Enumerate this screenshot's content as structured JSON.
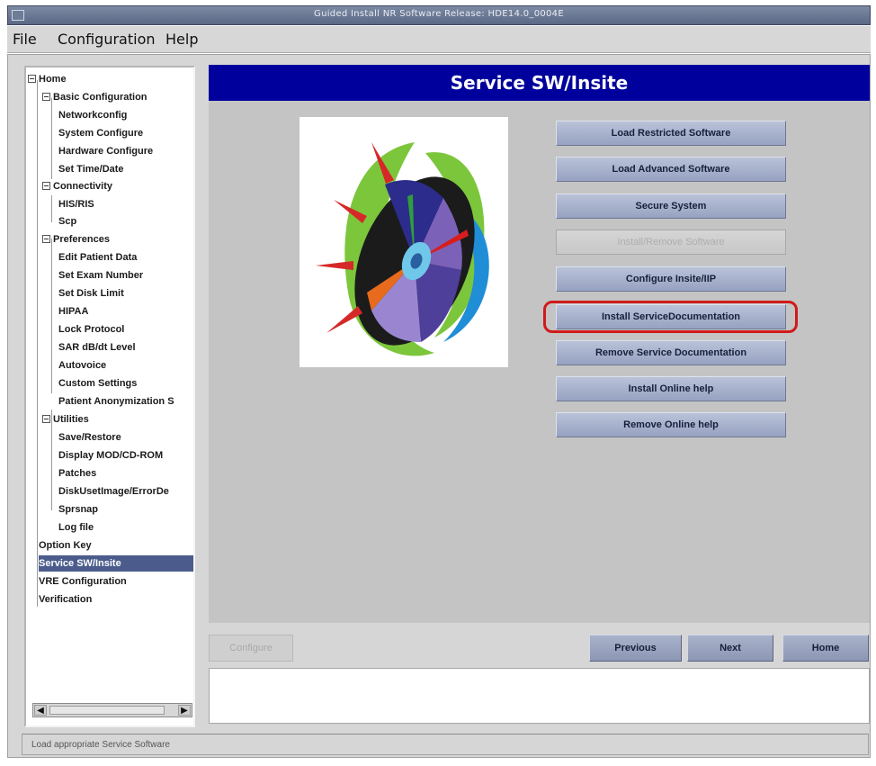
{
  "window": {
    "title": "Guided Install  NR Software Release: HDE14.0_0004E"
  },
  "menu": {
    "items": [
      "File",
      "Configuration",
      "Help"
    ]
  },
  "tree": {
    "root": "Home",
    "groups": [
      {
        "label": "Basic Configuration",
        "children": [
          "Networkconfig",
          "System Configure",
          "Hardware Configure",
          "Set Time/Date"
        ]
      },
      {
        "label": "Connectivity",
        "children": [
          "HIS/RIS",
          "Scp"
        ]
      },
      {
        "label": "Preferences",
        "children": [
          "Edit Patient Data",
          "Set Exam Number",
          "Set Disk Limit",
          "HIPAA",
          "Lock Protocol",
          "SAR dB/dt Level",
          "Autovoice",
          "Custom Settings",
          "Patient Anonymization S"
        ]
      },
      {
        "label": "Utilities",
        "children": [
          "Save/Restore",
          "Display MOD/CD-ROM",
          "Patches",
          "DiskUsetImage/ErrorDe",
          "Sprsnap",
          "Log file"
        ]
      }
    ],
    "top_level": [
      "Option Key",
      "Service SW/Insite",
      "VRE Configuration",
      "Verification"
    ],
    "selected": "Service SW/Insite"
  },
  "scrollbar": {
    "left_arrow": "◀",
    "right_arrow": "▶"
  },
  "header": {
    "title": "Service SW/Insite"
  },
  "image": {
    "icon": "cd-disc-icon"
  },
  "actions": [
    {
      "label": "Load Restricted Software",
      "enabled": true
    },
    {
      "label": "Load Advanced Software",
      "enabled": true
    },
    {
      "label": "Secure System",
      "enabled": true
    },
    {
      "label": "Install/Remove Software",
      "enabled": false
    },
    {
      "label": "Configure Insite/IIP",
      "enabled": true
    },
    {
      "label": "Install ServiceDocumentation",
      "enabled": true,
      "highlighted": true
    },
    {
      "label": "Remove Service Documentation",
      "enabled": true
    },
    {
      "label": "Install Online help",
      "enabled": true
    },
    {
      "label": "Remove Online help",
      "enabled": true
    }
  ],
  "nav": {
    "configure": "Configure",
    "previous": "Previous",
    "next": "Next",
    "home": "Home"
  },
  "status": {
    "text": "Load appropriate Service Software"
  },
  "colors": {
    "header": "#00009c",
    "button": "#a6b0cb",
    "selection": "#4b5c8c",
    "highlight": "#d11a1a"
  }
}
